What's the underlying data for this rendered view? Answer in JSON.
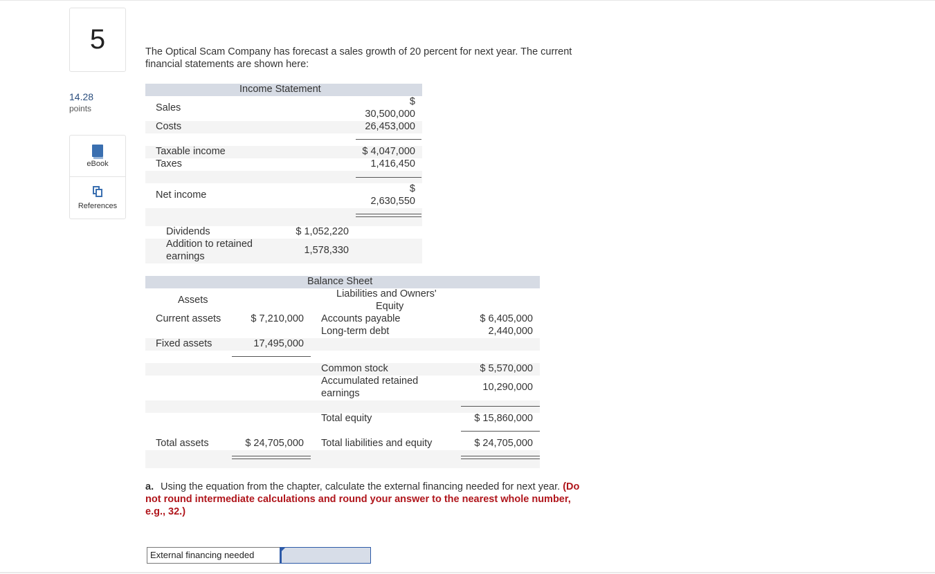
{
  "question_number": "5",
  "points": {
    "value": "14.28",
    "label": "points"
  },
  "tools": {
    "ebook": "eBook",
    "references": "References"
  },
  "intro": "The Optical Scam Company has forecast a sales growth of 20 percent for next year. The current financial statements are shown here:",
  "income_statement": {
    "title": "Income Statement",
    "sales": {
      "label": "Sales",
      "currency": "$",
      "value": "30,500,000"
    },
    "costs": {
      "label": "Costs",
      "value": "26,453,000"
    },
    "taxable_income": {
      "label": "Taxable income",
      "value": "$ 4,047,000"
    },
    "taxes": {
      "label": "Taxes",
      "value": "1,416,450"
    },
    "net_income": {
      "label": "Net income",
      "currency": "$",
      "value": "2,630,550"
    },
    "dividends": {
      "label": "Dividends",
      "value": "$ 1,052,220"
    },
    "addition_retained": {
      "label_line1": "Addition to retained",
      "label_line2": "earnings",
      "value": "1,578,330"
    }
  },
  "balance_sheet": {
    "title": "Balance Sheet",
    "assets_header": "Assets",
    "liab_header_line1": "Liabilities and Owners'",
    "liab_header_line2": "Equity",
    "current_assets": {
      "label": "Current assets",
      "value": "$ 7,210,000"
    },
    "fixed_assets": {
      "label": "Fixed assets",
      "value": "17,495,000"
    },
    "total_assets": {
      "label": "Total assets",
      "value": "$ 24,705,000"
    },
    "accounts_payable": {
      "label": "Accounts payable",
      "value": "$ 6,405,000"
    },
    "long_term_debt": {
      "label": "Long-term debt",
      "value": "2,440,000"
    },
    "common_stock": {
      "label": "Common stock",
      "value": "$ 5,570,000"
    },
    "accum_retained": {
      "label_line1": "Accumulated retained",
      "label_line2": "earnings",
      "value": "10,290,000"
    },
    "total_equity": {
      "label": "Total equity",
      "value": "$ 15,860,000"
    },
    "total_liab_equity": {
      "label": "Total liabilities and equity",
      "value": "$ 24,705,000"
    }
  },
  "question": {
    "lead": "a.",
    "text": " Using the equation from the chapter, calculate the external financing needed for next year. ",
    "note": "(Do not round intermediate calculations and round your answer to the nearest whole number, e.g., 32.)"
  },
  "answer": {
    "label": "External financing needed",
    "value": ""
  }
}
